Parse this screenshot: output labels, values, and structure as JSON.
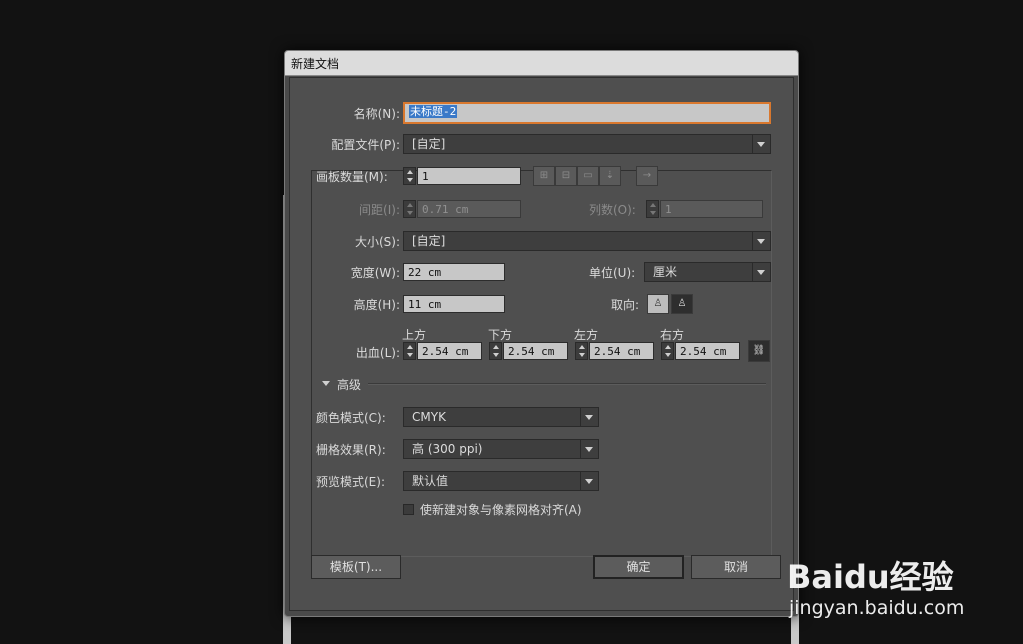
{
  "dialog": {
    "title": "新建文档",
    "name_label": "名称(N):",
    "name_value": "未标题-2",
    "profile_label": "配置文件(P):",
    "profile_value": "[自定]",
    "artboards_label": "画板数量(M):",
    "artboards_value": "1",
    "spacing_label": "间距(I):",
    "spacing_value": "0.71 cm",
    "columns_label": "列数(O):",
    "columns_value": "1",
    "size_label": "大小(S):",
    "size_value": "[自定]",
    "width_label": "宽度(W):",
    "width_value": "22 cm",
    "units_label": "单位(U):",
    "units_value": "厘米",
    "height_label": "高度(H):",
    "height_value": "11 cm",
    "orientation_label": "取向:",
    "bleed_label": "出血(L):",
    "bleed": {
      "top_label": "上方",
      "top_value": "2.54 cm",
      "bottom_label": "下方",
      "bottom_value": "2.54 cm",
      "left_label": "左方",
      "left_value": "2.54 cm",
      "right_label": "右方",
      "right_value": "2.54 cm"
    },
    "advanced_label": "高级",
    "color_mode_label": "颜色模式(C):",
    "color_mode_value": "CMYK",
    "raster_label": "栅格效果(R):",
    "raster_value": "高 (300 ppi)",
    "preview_label": "预览模式(E):",
    "preview_value": "默认值",
    "align_pixel_label": "使新建对象与像素网格对齐(A)",
    "template_button": "模板(T)...",
    "ok_button": "确定",
    "cancel_button": "取消"
  },
  "watermark": {
    "brand": "Baidu经验",
    "url": "jingyan.baidu.com"
  }
}
